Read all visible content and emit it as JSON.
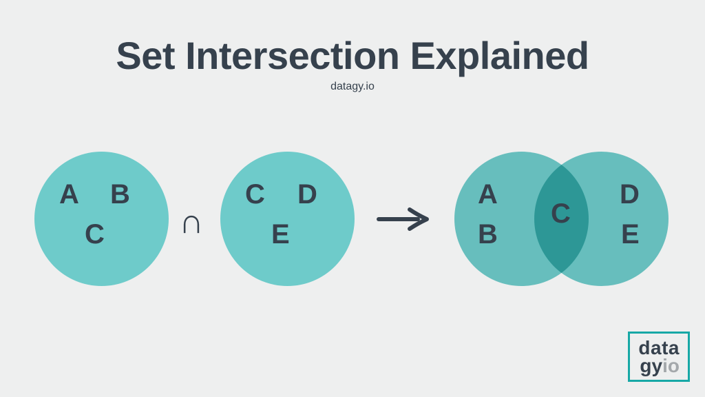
{
  "header": {
    "title": "Set Intersection Explained",
    "subtitle": "datagy.io"
  },
  "sets": {
    "left": [
      "A",
      "B",
      "C"
    ],
    "right": [
      "C",
      "D",
      "E"
    ],
    "operator": "∩"
  },
  "venn": {
    "left_only": [
      "A",
      "B"
    ],
    "intersection": [
      "C"
    ],
    "right_only": [
      "D",
      "E"
    ]
  },
  "logo": {
    "line1": "data",
    "line2_a": "gy",
    "line2_b": "io"
  },
  "colors": {
    "circle": "#6ecbca",
    "text": "#36414d",
    "logo_border": "#17a8a6",
    "logo_muted": "#a4a8ab",
    "background": "#eeefef"
  }
}
